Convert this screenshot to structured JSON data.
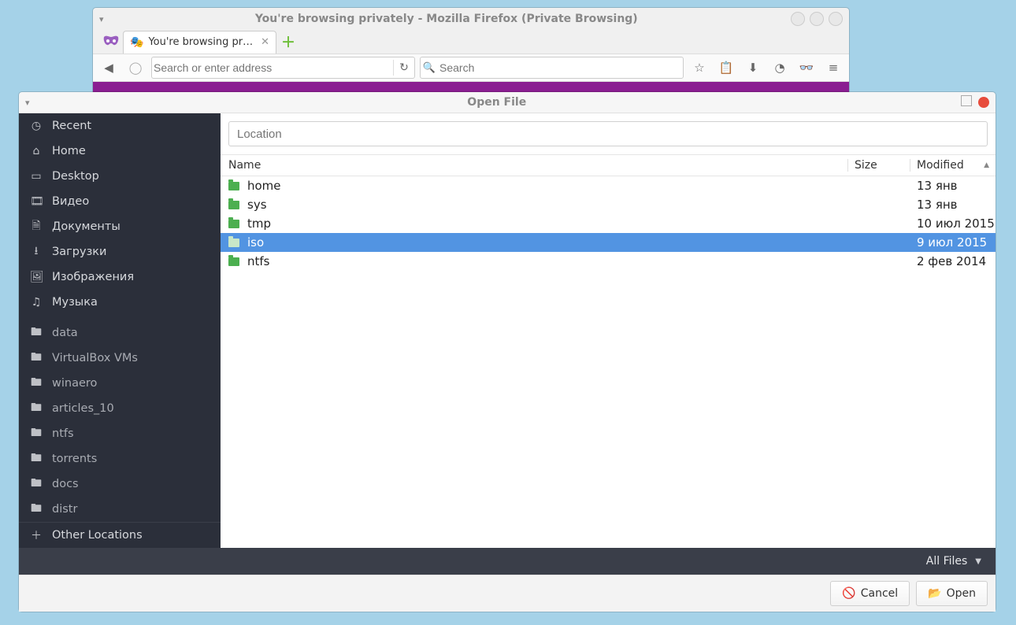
{
  "firefox": {
    "window_title": "You're browsing privately - Mozilla Firefox (Private Browsing)",
    "tab_label": "You're browsing pr…",
    "url_placeholder": "Search or enter address",
    "search_placeholder": "Search"
  },
  "dialog": {
    "title": "Open File",
    "location_placeholder": "Location",
    "columns": {
      "name": "Name",
      "size": "Size",
      "modified": "Modified"
    },
    "sidebar_places": [
      {
        "icon": "clock",
        "label": "Recent"
      },
      {
        "icon": "home",
        "label": "Home"
      },
      {
        "icon": "desktop",
        "label": "Desktop"
      },
      {
        "icon": "video",
        "label": "Видео"
      },
      {
        "icon": "doc",
        "label": "Документы"
      },
      {
        "icon": "download",
        "label": "Загрузки"
      },
      {
        "icon": "image",
        "label": "Изображения"
      },
      {
        "icon": "music",
        "label": "Музыка"
      }
    ],
    "sidebar_bookmarks": [
      {
        "label": "data"
      },
      {
        "label": "VirtualBox VMs"
      },
      {
        "label": "winaero"
      },
      {
        "label": "articles_10"
      },
      {
        "label": "ntfs"
      },
      {
        "label": "torrents"
      },
      {
        "label": "docs"
      },
      {
        "label": "distr"
      }
    ],
    "other_locations_label": "Other Locations",
    "rows": [
      {
        "name": "home",
        "size": "",
        "modified": "13 янв",
        "selected": false
      },
      {
        "name": "sys",
        "size": "",
        "modified": "13 янв",
        "selected": false
      },
      {
        "name": "tmp",
        "size": "",
        "modified": "10 июл 2015",
        "selected": false
      },
      {
        "name": "iso",
        "size": "",
        "modified": "9 июл 2015",
        "selected": true
      },
      {
        "name": "ntfs",
        "size": "",
        "modified": "2 фев 2014",
        "selected": false
      }
    ],
    "filter_label": "All Files",
    "cancel_label": "Cancel",
    "open_label": "Open"
  }
}
